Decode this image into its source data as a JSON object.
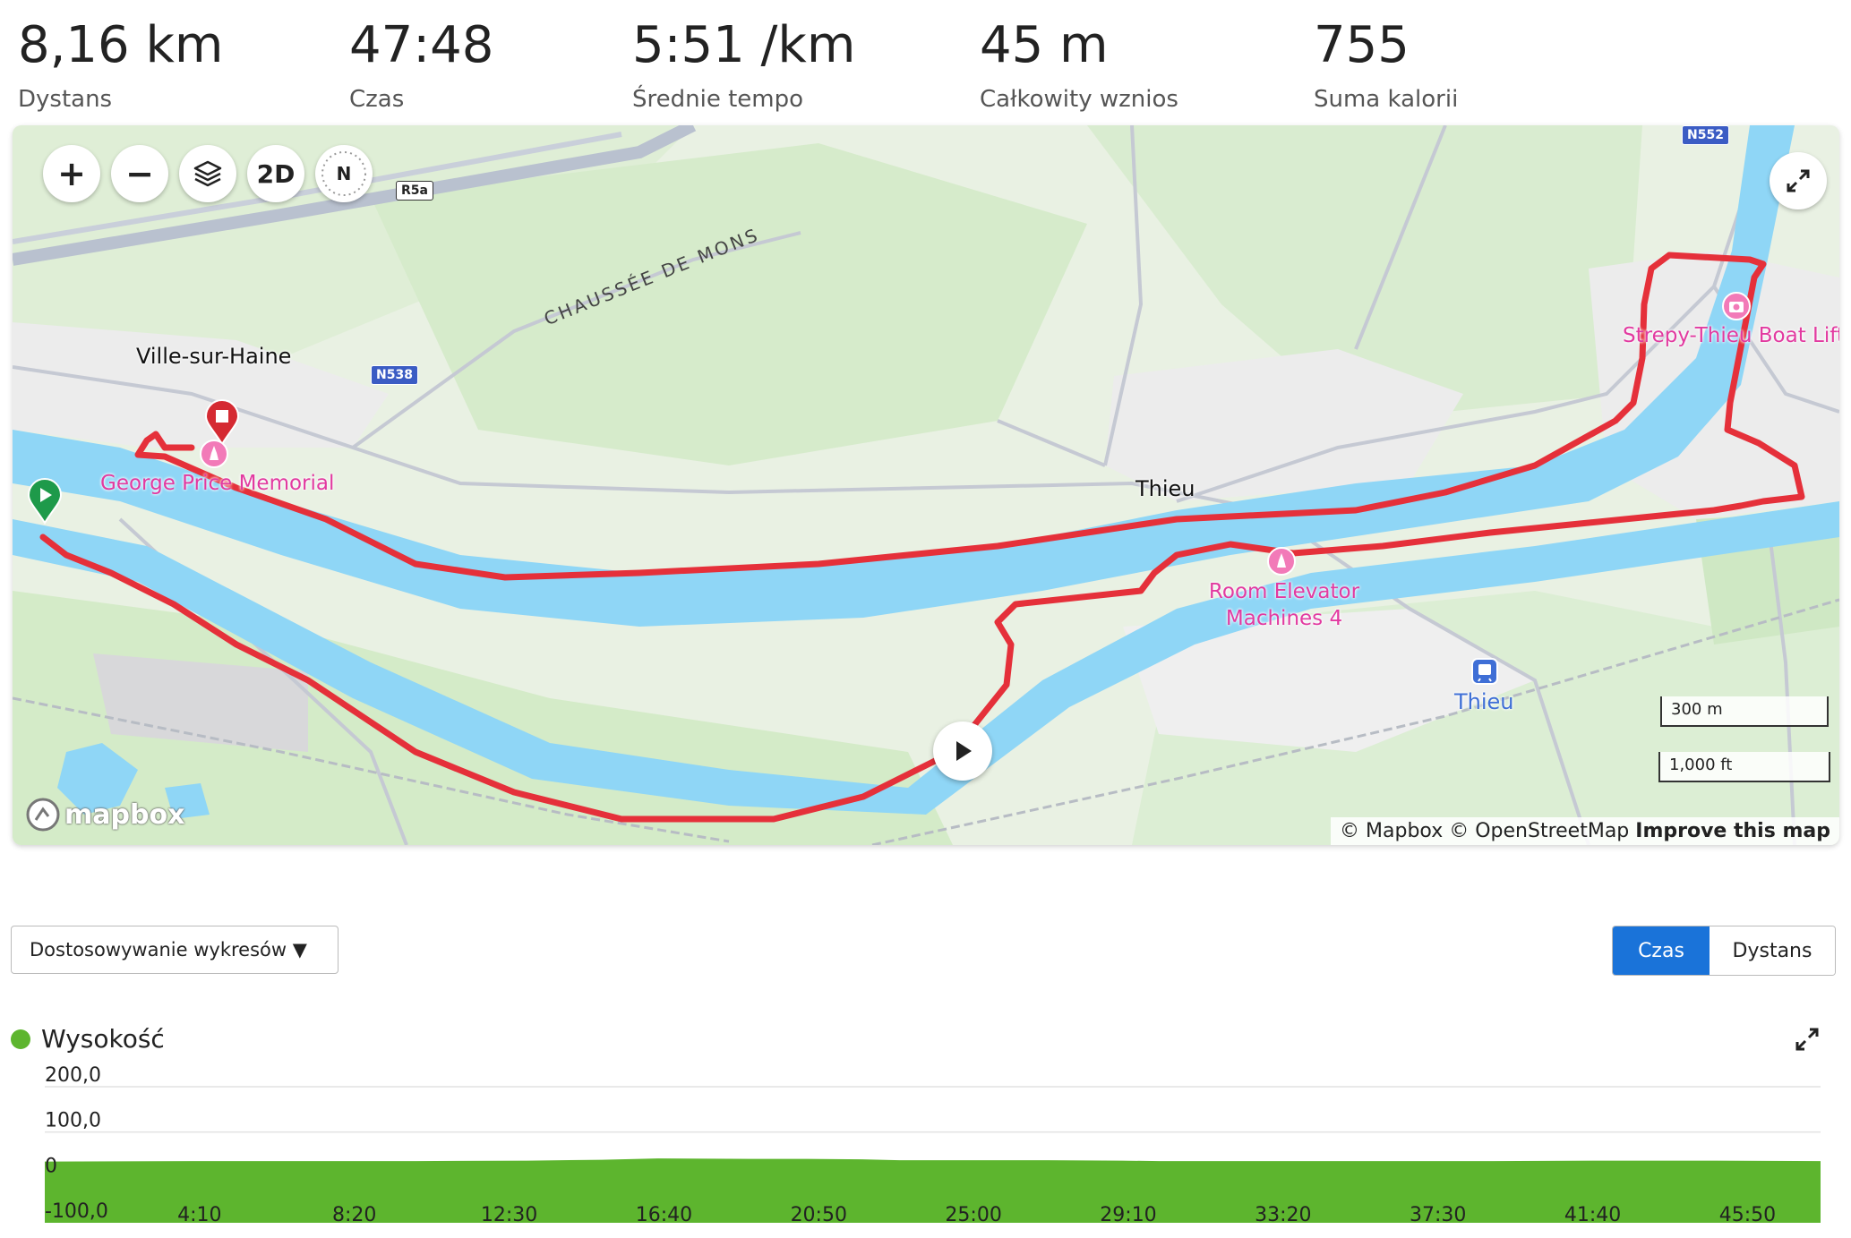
{
  "stats": [
    {
      "value": "8,16 km",
      "label": "Dystans"
    },
    {
      "value": "47:48",
      "label": "Czas"
    },
    {
      "value": "5:51 /km",
      "label": "Średnie tempo"
    },
    {
      "value": "45 m",
      "label": "Całkowity wznios"
    },
    {
      "value": "755",
      "label": "Suma kalorii"
    }
  ],
  "map": {
    "controls": {
      "zoom_in": "+",
      "zoom_out": "−",
      "view_mode": "2D",
      "compass": "N"
    },
    "road_badges": {
      "r5a": "R5a",
      "n538": "N538",
      "n552": "N552"
    },
    "road_label": "CHAUSSÉE DE MONS",
    "places": {
      "ville": "Ville-sur-Haine",
      "thieu": "Thieu"
    },
    "pois": {
      "memorial": "George Price Memorial",
      "elevator": "Room Elevator\nMachines 4",
      "boat_lift": "Strepy-Thieu Boat Lift",
      "station": "Thieu"
    },
    "scale": {
      "metric": "300 m",
      "imperial": "1,000 ft"
    },
    "attribution": {
      "mapbox": "© Mapbox",
      "osm": "© OpenStreetMap",
      "improve": "Improve this map"
    },
    "logo": "mapbox",
    "colors": {
      "route": "#e5303a",
      "water": "#8fd6f6",
      "land": "#e9f1e3",
      "park": "#cfe8c4"
    }
  },
  "controls_row": {
    "dropdown_label": "Dostosowywanie wykresów ▼",
    "toggle": {
      "active": "Czas",
      "inactive": "Dystans"
    }
  },
  "chart_data": {
    "type": "area",
    "title": "Wysokość",
    "color": "#5db52e",
    "ylim": [
      -100,
      200
    ],
    "yticks": [
      "200,0",
      "100,0",
      "0",
      "-100,0"
    ],
    "xticks": [
      "4:10",
      "8:20",
      "12:30",
      "16:40",
      "20:50",
      "25:00",
      "29:10",
      "33:20",
      "37:30",
      "41:40",
      "45:50"
    ],
    "xlim_minutes": [
      0,
      47.8
    ],
    "x": [
      0,
      4,
      8,
      10,
      13,
      15,
      16.5,
      19,
      20.5,
      22,
      23,
      25,
      27,
      29,
      30,
      33,
      36,
      39,
      42,
      45,
      47.8
    ],
    "y": [
      35,
      36,
      36,
      36,
      37,
      39,
      42,
      41,
      41,
      40,
      38,
      38,
      38,
      37,
      36,
      36,
      36,
      36,
      37,
      37,
      36
    ]
  }
}
